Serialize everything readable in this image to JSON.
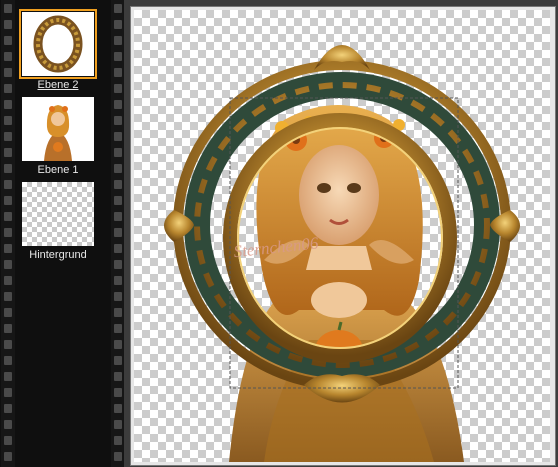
{
  "layers_panel": {
    "layers": [
      {
        "name": "Ebene 2",
        "active": true,
        "thumb_icon": "wreath-icon"
      },
      {
        "name": "Ebene 1",
        "active": false,
        "thumb_icon": "woman-figure-icon"
      },
      {
        "name": "Hintergrund",
        "active": false,
        "thumb_icon": "transparent-checker-icon"
      }
    ]
  },
  "canvas": {
    "watermark": "Sternchen06",
    "colors": {
      "frame_gold": "#b8862e",
      "frame_green": "#2f4a3a",
      "hair": "#d9962a",
      "dress": "#c9862c",
      "selection_accent": "#f0a020"
    }
  }
}
